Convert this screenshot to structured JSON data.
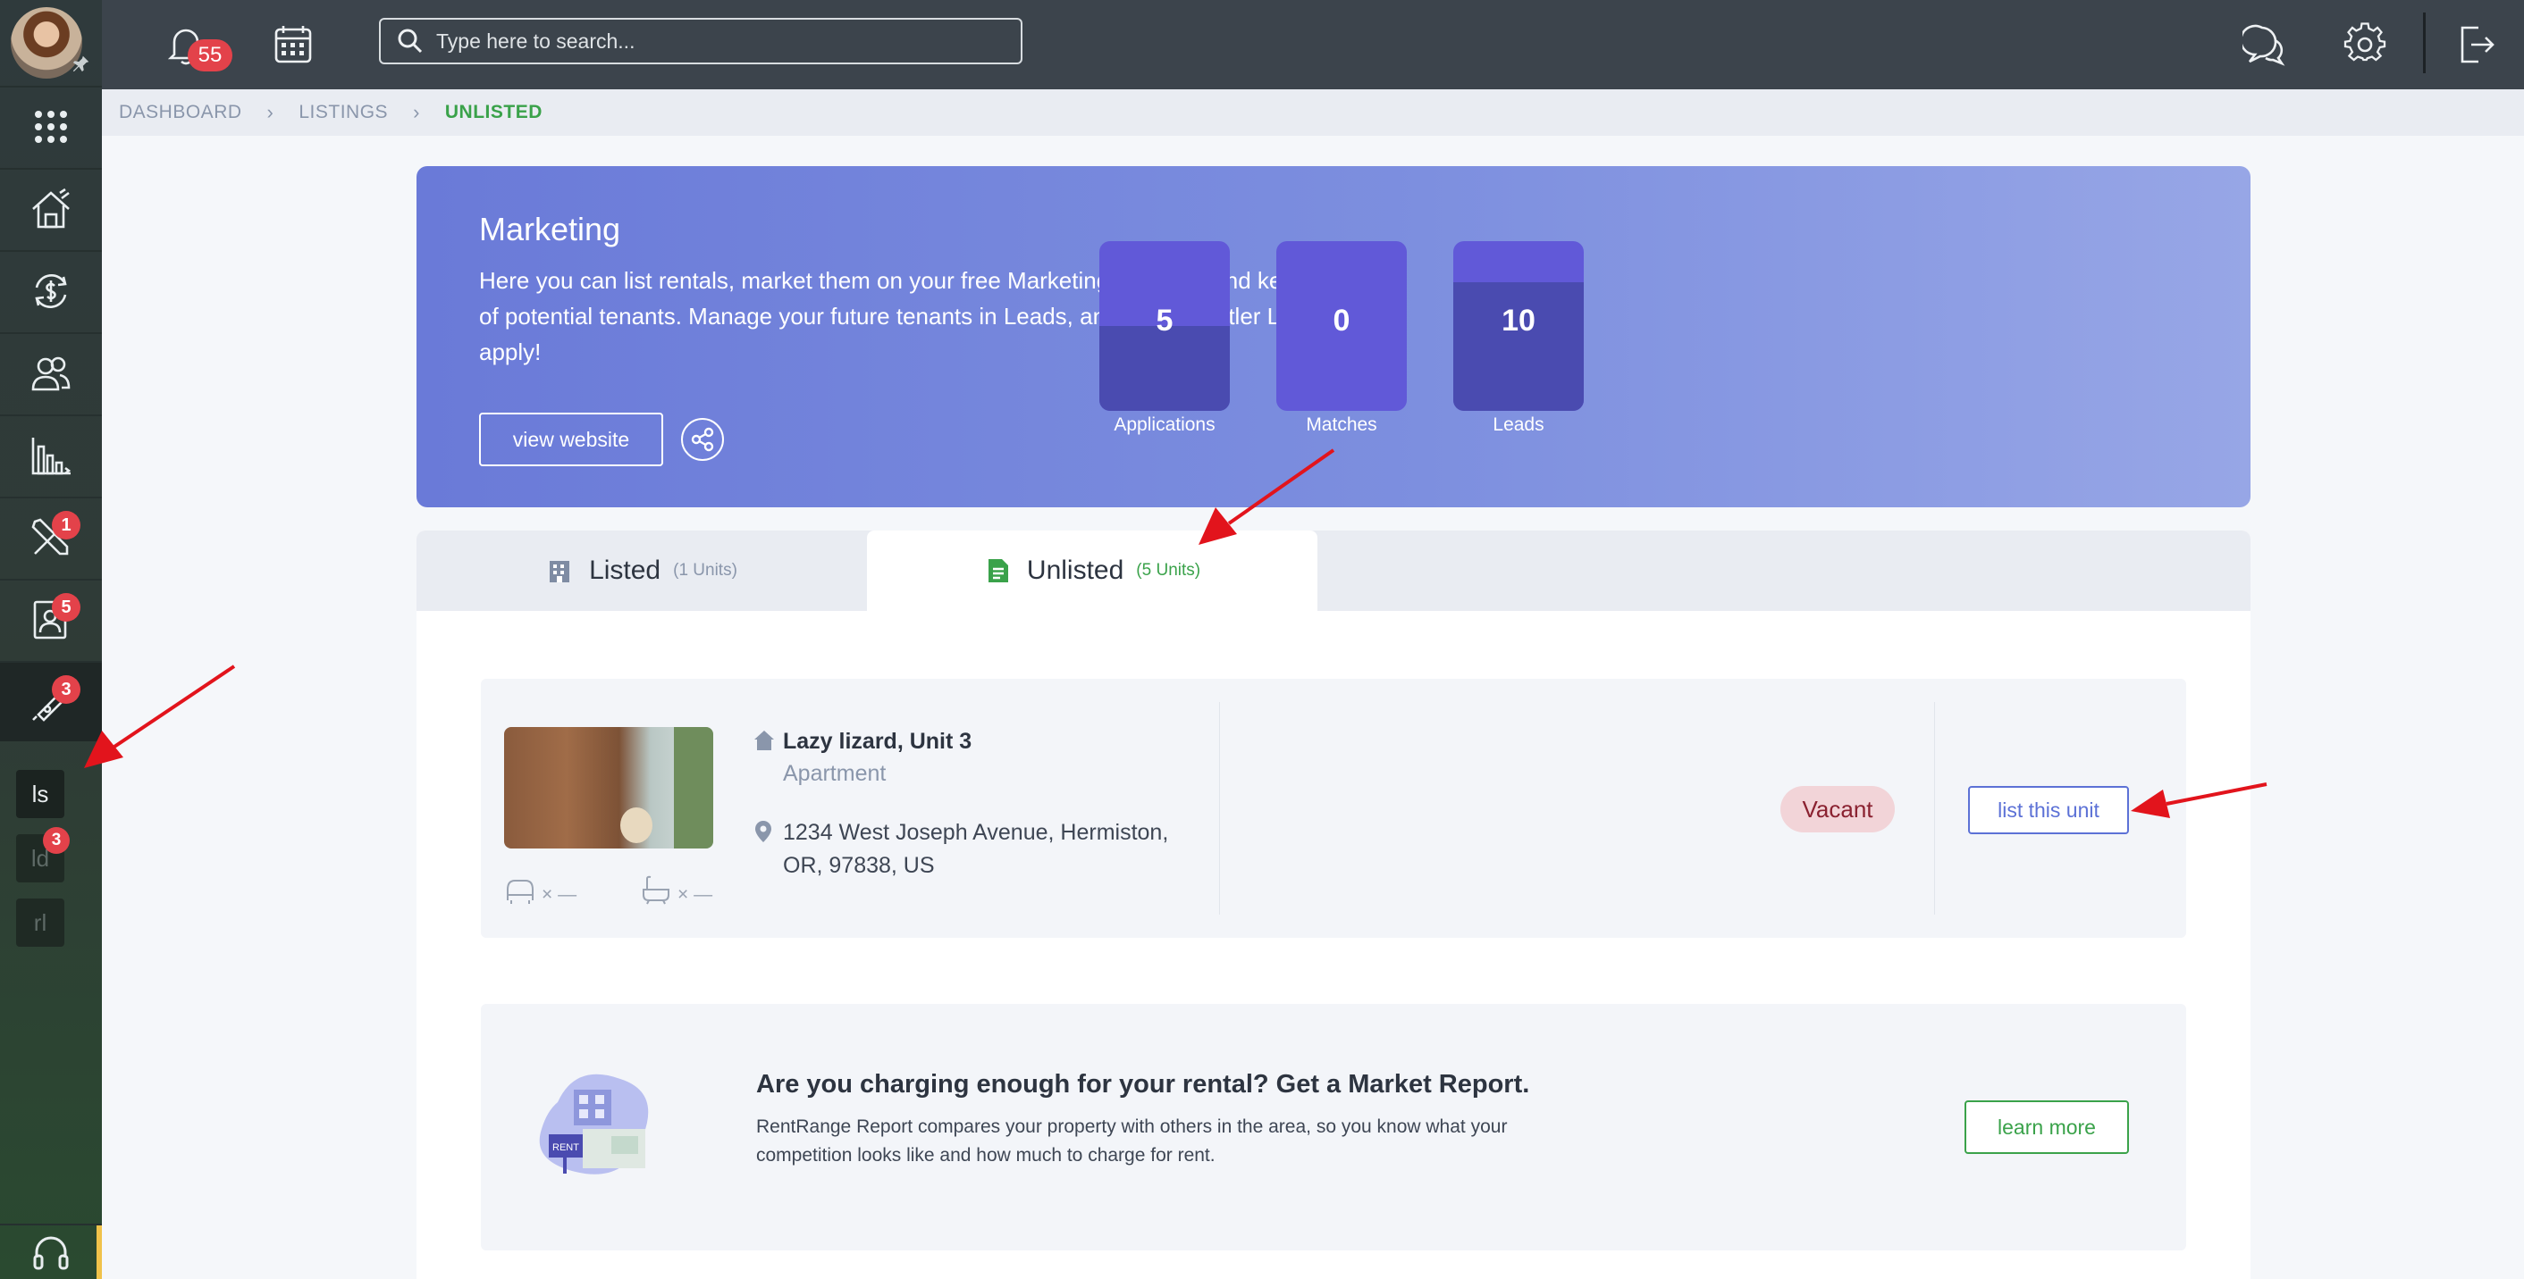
{
  "topbar": {
    "notification_count": "55",
    "search_placeholder": "Type here to search..."
  },
  "sidebar": {
    "badges": {
      "maintenance": "1",
      "applications": "5",
      "leads": "3",
      "leads_sub": "3"
    },
    "sub_items": [
      "ls",
      "ld",
      "rl"
    ]
  },
  "breadcrumb": [
    "DASHBOARD",
    "LISTINGS",
    "UNLISTED"
  ],
  "banner": {
    "title": "Marketing",
    "text": "Here you can list rentals, market them on your free Marketing Website, and keep track of potential tenants. Manage your future tenants in Leads, and invite Rentler Leads to apply!",
    "view_website": "view website",
    "stats": [
      {
        "value": "5",
        "label": "Applications",
        "fill_fraction": 0.5
      },
      {
        "value": "0",
        "label": "Matches",
        "fill_fraction": 0
      },
      {
        "value": "10",
        "label": "Leads",
        "fill_fraction": 0.76
      }
    ]
  },
  "tabs": [
    {
      "label": "Listed",
      "count": "(1 Units)",
      "active": false
    },
    {
      "label": "Unlisted",
      "count": "(5 Units)",
      "active": true
    }
  ],
  "unit": {
    "name": "Lazy lizard, Unit 3",
    "type": "Apartment",
    "address": "1234 West Joseph Avenue, Hermiston, OR, 97838, US",
    "beds": "× —",
    "baths": "× —",
    "status": "Vacant",
    "action": "list this unit"
  },
  "report": {
    "title": "Are you charging enough for your rental? Get a Market Report.",
    "text": "RentRange Report compares your property with others in the area, so you know what your competition looks like and how much to charge for rent.",
    "illustration_sign": "RENT",
    "action": "learn more"
  },
  "colors": {
    "accent_green": "#3aa24a",
    "accent_blue": "#5c71d6",
    "badge_red": "#e3424a",
    "banner": "#6a7ad8"
  }
}
